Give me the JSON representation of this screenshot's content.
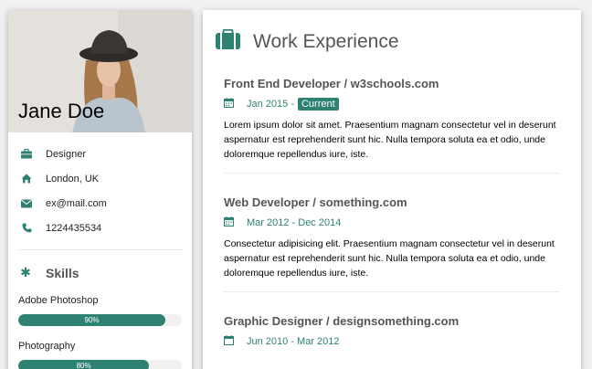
{
  "profile": {
    "name": "Jane Doe",
    "info": [
      {
        "icon": "briefcase-icon",
        "text": "Designer"
      },
      {
        "icon": "home-icon",
        "text": "London, UK"
      },
      {
        "icon": "envelope-icon",
        "text": "ex@mail.com"
      },
      {
        "icon": "phone-icon",
        "text": "1224435534"
      }
    ]
  },
  "skills": {
    "title": "Skills",
    "items": [
      {
        "label": "Adobe Photoshop",
        "value": 90,
        "text": "90%"
      },
      {
        "label": "Photography",
        "value": 80,
        "text": "80%"
      }
    ]
  },
  "experience": {
    "title": "Work Experience",
    "jobs": [
      {
        "title": "Front End Developer / w3schools.com",
        "date": "Jan 2015 -",
        "badge": "Current",
        "desc": "Lorem ipsum dolor sit amet. Praesentium magnam consectetur vel in deserunt aspernatur est reprehenderit sunt hic. Nulla tempora soluta ea et odio, unde doloremque repellendus iure, iste."
      },
      {
        "title": "Web Developer / something.com",
        "date": "Mar 2012 - Dec 2014",
        "desc": "Consectetur adipisicing elit. Praesentium magnam consectetur vel in deserunt aspernatur est reprehenderit sunt hic. Nulla tempora soluta ea et odio, unde doloremque repellendus iure, iste."
      },
      {
        "title": "Graphic Designer / designsomething.com",
        "date": "Jun 2010 - Mar 2012"
      }
    ]
  },
  "colors": {
    "accent": "#2e8272",
    "heading": "#555555"
  }
}
